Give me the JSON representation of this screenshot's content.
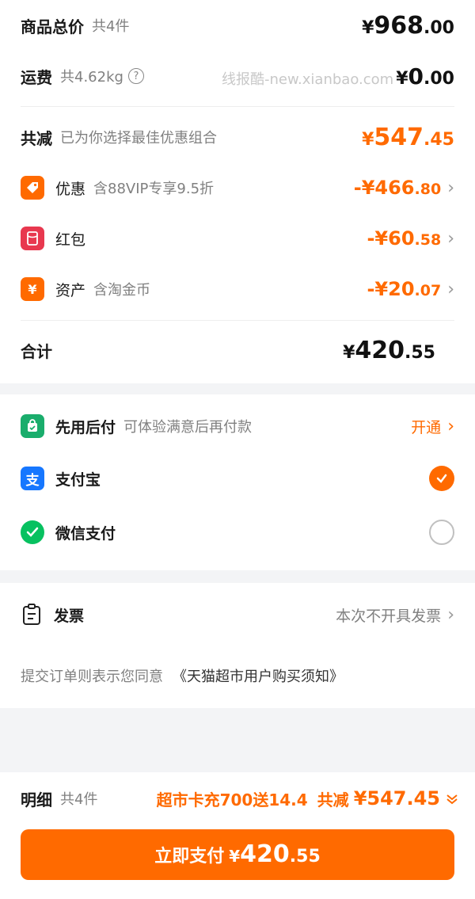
{
  "summary": {
    "goods_total_label": "商品总价",
    "goods_count": "共4件",
    "goods_total_int": "968",
    "goods_total_dec": ".00",
    "shipping_label": "运费",
    "shipping_weight": "共4.62kg",
    "shipping_int": "0",
    "shipping_dec": ".00",
    "watermark": "线报酷-new.xianbao.com",
    "reduction_label": "共减",
    "reduction_sub": "已为你选择最佳优惠组合",
    "reduction_int": "547",
    "reduction_dec": ".45",
    "currency": "¥",
    "discounts": [
      {
        "name": "优惠",
        "sub": "含88VIP专享9.5折",
        "int": "-¥466",
        "dec": ".80",
        "icon": "tag-icon",
        "color": "#ff6a00"
      },
      {
        "name": "红包",
        "sub": "",
        "int": "-¥60",
        "dec": ".58",
        "icon": "red-packet-icon",
        "color": "#e8384f"
      },
      {
        "name": "资产",
        "sub": "含淘金币",
        "int": "-¥20",
        "dec": ".07",
        "icon": "yuan-icon",
        "color": "#ff6a00"
      }
    ],
    "total_label": "合计",
    "total_int": "420",
    "total_dec": ".55"
  },
  "payment": {
    "paylater_label": "先用后付",
    "paylater_sub": "可体验满意后再付款",
    "paylater_action": "开通",
    "alipay_label": "支付宝",
    "wechat_label": "微信支付",
    "alipay_glyph": "支",
    "selected": "alipay"
  },
  "invoice": {
    "label": "发票",
    "value": "本次不开具发票",
    "agreement_prefix": "提交订单则表示您同意",
    "agreement_link": "《天猫超市用户购买须知》"
  },
  "footer": {
    "detail_label": "明细",
    "detail_count": "共4件",
    "promo": "超市卡充700送14.4",
    "reduction_label": "共减",
    "reduction_value": "¥547.45",
    "pay_button_label": "立即支付",
    "pay_currency": "¥",
    "pay_int": "420",
    "pay_dec": ".55"
  },
  "colors": {
    "accent": "#ff6a00",
    "alipay": "#1677ff",
    "wechat": "#07c160",
    "paylater": "#1aad6c"
  }
}
